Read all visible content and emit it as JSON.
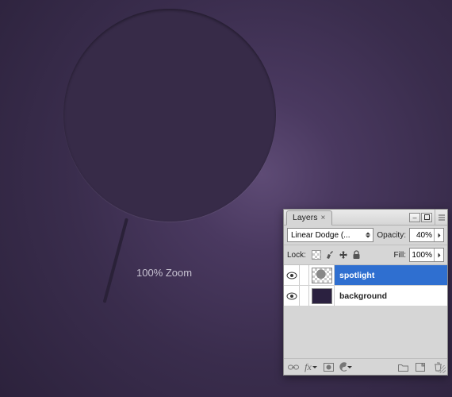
{
  "canvas": {
    "zoom_label": "100% Zoom"
  },
  "panel": {
    "tab_title": "Layers",
    "blend_mode": "Linear Dodge (...",
    "opacity_label": "Opacity:",
    "opacity_value": "40%",
    "lock_label": "Lock:",
    "fill_label": "Fill:",
    "fill_value": "100%",
    "layers": [
      {
        "name": "spotlight",
        "visible": true,
        "selected": true,
        "thumb": "spot"
      },
      {
        "name": "background",
        "visible": true,
        "selected": false,
        "thumb": "bg"
      }
    ]
  }
}
